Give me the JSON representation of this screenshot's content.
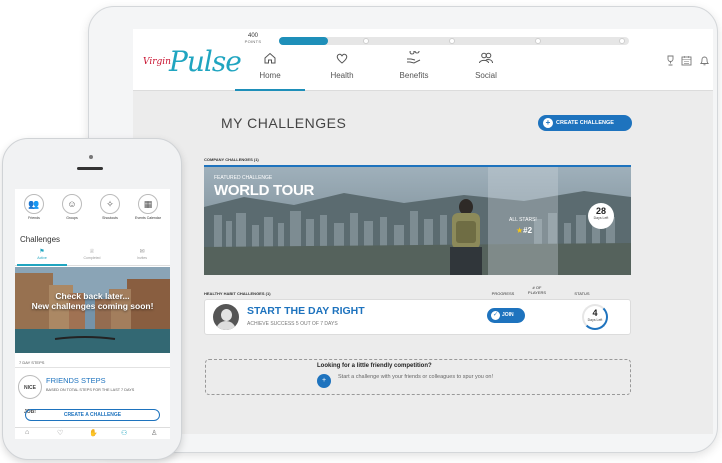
{
  "tablet": {
    "brand": {
      "virgin": "Virgin",
      "pulse": "Pulse"
    },
    "points": {
      "value": "400",
      "label": "POINTS"
    },
    "points_progress_fraction": 0.14,
    "nav": [
      {
        "label": "Home",
        "icon": "home-icon"
      },
      {
        "label": "Health",
        "icon": "heart-icon"
      },
      {
        "label": "Benefits",
        "icon": "benefits-icon"
      },
      {
        "label": "Social",
        "icon": "social-icon"
      }
    ],
    "page_title": "MY CHALLENGES",
    "create_button": "CREATE CHALLENGE",
    "company_section": "COMPANY CHALLENGES (1)",
    "featured": {
      "kicker": "FEATURED CHALLENGE",
      "title": "WORLD TOUR",
      "all_stars": "ALL STARS!",
      "rank": "#2",
      "days_left_num": "28",
      "days_left_label": "Days Left"
    },
    "habit_section": "HEALTHY HABIT CHALLENGES (1)",
    "columns": {
      "progress": "PROGRESS",
      "players": "# OF PLAYERS",
      "status": "STATUS"
    },
    "habit": {
      "title": "START THE DAY RIGHT",
      "subtitle": "ACHIEVE SUCCESS 5 OUT OF 7 DAYS",
      "join": "JOIN",
      "days_left_num": "4",
      "days_left_label": "Days Left"
    },
    "promo": {
      "title": "Looking for a little friendly competition?",
      "text": "Start a challenge with your friends or colleagues to spur you on!"
    }
  },
  "phone": {
    "shortcuts": [
      {
        "label": "Friends",
        "icon": "friends-icon"
      },
      {
        "label": "Groups",
        "icon": "groups-icon"
      },
      {
        "label": "Shoutouts",
        "icon": "shoutouts-icon"
      },
      {
        "label": "Events Calendar",
        "icon": "calendar-icon"
      }
    ],
    "title": "Challenges",
    "tabs": [
      {
        "label": "Active"
      },
      {
        "label": "Completed"
      },
      {
        "label": "Invites"
      }
    ],
    "empty_line1": "Check back later...",
    "empty_line2": "New challenges coming soon!",
    "steps_section": "7 DAY STEPS",
    "nice_job": "NICE JOB!",
    "friends_steps_title": "FRIENDS STEPS",
    "friends_steps_sub": "BASED ON TOTAL STEPS FOR THE LAST 7 DAYS",
    "create_button": "CREATE A CHALLENGE"
  },
  "colors": {
    "brand_blue": "#1e73be",
    "pulse_teal": "#20a5c0"
  }
}
